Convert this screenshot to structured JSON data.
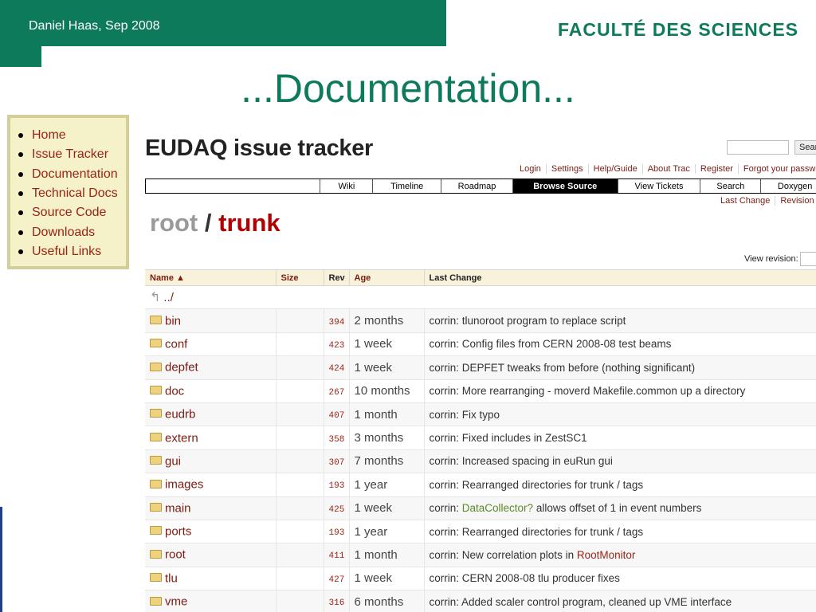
{
  "slide": {
    "author": "Daniel Haas, Sep 2008",
    "faculty": "FACULTÉ DES SCIENCES",
    "title": "...Documentation...",
    "accent_color": "#0e7a5c"
  },
  "nav": [
    {
      "label": "Home"
    },
    {
      "label": "Issue Tracker"
    },
    {
      "label": "Documentation"
    },
    {
      "label": "Technical Docs"
    },
    {
      "label": "Source Code"
    },
    {
      "label": "Downloads"
    },
    {
      "label": "Useful Links"
    }
  ],
  "trac": {
    "title": "EUDAQ issue tracker",
    "search_button": "Sear",
    "meta": [
      "Login",
      "Settings",
      "Help/Guide",
      "About Trac",
      "Register",
      "Forgot your passwo"
    ],
    "mainnav": [
      "Wiki",
      "Timeline",
      "Roadmap",
      "Browse Source",
      "View Tickets",
      "Search",
      "Doxygen"
    ],
    "active_tab": "Browse Source",
    "ctxnav": [
      "Last Change",
      "Revision L"
    ],
    "path_root": "root",
    "path_sep": "/",
    "path_trunk": "trunk",
    "view_revision_label": "View revision:",
    "headers": {
      "name": "Name ▲",
      "size": "Size",
      "rev": "Rev",
      "age": "Age",
      "last_change": "Last Change"
    },
    "up_label": "../",
    "rows": [
      {
        "name": "bin",
        "rev": "394",
        "age": "2 months",
        "change": "corrin: tlunoroot program to replace script"
      },
      {
        "name": "conf",
        "rev": "423",
        "age": "1 week",
        "change": "corrin: Config files from CERN 2008-08 test beams"
      },
      {
        "name": "depfet",
        "rev": "424",
        "age": "1 week",
        "change": "corrin: DEPFET tweaks from before (nothing significant)"
      },
      {
        "name": "doc",
        "rev": "267",
        "age": "10 months",
        "change": "corrin: More rearranging - moverd Makefile.common up a directory"
      },
      {
        "name": "eudrb",
        "rev": "407",
        "age": "1 month",
        "change": "corrin: Fix typo"
      },
      {
        "name": "extern",
        "rev": "358",
        "age": "3 months",
        "change": "corrin: Fixed includes in ZestSC1"
      },
      {
        "name": "gui",
        "rev": "307",
        "age": "7 months",
        "change": "corrin: Increased spacing in euRun gui"
      },
      {
        "name": "images",
        "rev": "193",
        "age": "1 year",
        "change": "corrin: Rearranged directories for trunk / tags"
      },
      {
        "name": "main",
        "rev": "425",
        "age": "1 week",
        "change_pre": "corrin: ",
        "change_link": "DataCollector?",
        "change_post": " allows offset of 1 in event numbers"
      },
      {
        "name": "ports",
        "rev": "193",
        "age": "1 year",
        "change": "corrin: Rearranged directories for trunk / tags"
      },
      {
        "name": "root",
        "rev": "411",
        "age": "1 month",
        "change_pre": "corrin: New correlation plots in ",
        "change_link2": "RootMonitor",
        "change_post": ""
      },
      {
        "name": "tlu",
        "rev": "427",
        "age": "1 week",
        "change": "corrin: CERN 2008-08 tlu producer fixes"
      },
      {
        "name": "vme",
        "rev": "316",
        "age": "6 months",
        "change": "corrin: Added scaler control program, cleaned up VME interface"
      }
    ]
  }
}
